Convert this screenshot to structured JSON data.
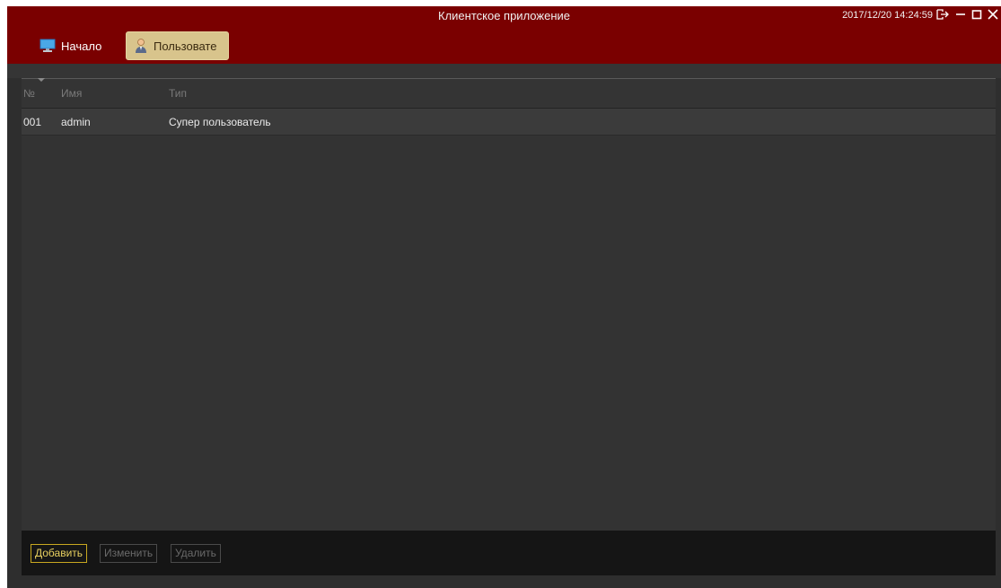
{
  "window": {
    "title": "Клиентское приложение",
    "datetime": "2017/12/20 14:24:59"
  },
  "nav": {
    "tabs": [
      {
        "label": "Начало",
        "icon": "monitor-icon",
        "active": false
      },
      {
        "label": "Пользовате",
        "icon": "user-icon",
        "active": true
      }
    ]
  },
  "table": {
    "columns": [
      "№",
      "Имя",
      "Тип"
    ],
    "rows": [
      {
        "no": "001",
        "name": "admin",
        "type": "Супер пользователь"
      }
    ]
  },
  "actions": {
    "add": "Добавить",
    "edit": "Изменить",
    "delete": "Удалить"
  },
  "colors": {
    "titlebar": "#7a0000",
    "active_tab": "#d8c48c",
    "primary_button": "#c8a820"
  }
}
